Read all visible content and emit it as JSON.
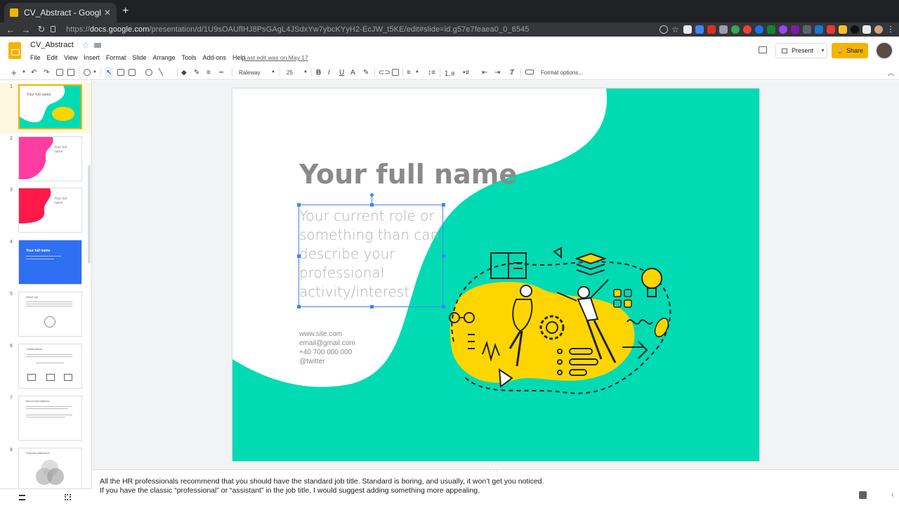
{
  "browser": {
    "tab_title": "CV_Abstract - Google Slides",
    "tab_close": "✕",
    "new_tab": "+",
    "url_prefix": "https://",
    "url_host": "docs.google.com",
    "url_path": "/presentation/d/1U9sOAUflHJ8PsGAgL4JSdxYw7ybcKYyH2-EcJW_t5KE/edit#slide=id.g57e7feaea0_0_6545"
  },
  "doc": {
    "title": "CV_Abstract",
    "menus": [
      "File",
      "Edit",
      "View",
      "Insert",
      "Format",
      "Slide",
      "Arrange",
      "Tools",
      "Add-ons",
      "Help"
    ],
    "last_edit": "Last edit was on May 17",
    "present_label": "Present",
    "share_label": "Share"
  },
  "toolbar": {
    "font": "Raleway",
    "font_size": "25",
    "format_options": "Format options..."
  },
  "filmstrip": {
    "slides": [
      {
        "num": "1",
        "title": "Your full name"
      },
      {
        "num": "2",
        "title": "Your full name"
      },
      {
        "num": "3",
        "title": "Your full name"
      },
      {
        "num": "4",
        "title": "Your full name"
      },
      {
        "num": "5",
        "title": "About me"
      },
      {
        "num": "6",
        "title": "Certifications"
      },
      {
        "num": "7",
        "title": "Recommendations"
      },
      {
        "num": "8",
        "title": "Purpose statement"
      }
    ]
  },
  "slide": {
    "title": "Your full name",
    "subtitle": "Your current role or something than can describe your professional activity/interest",
    "contacts": [
      "www.site.com",
      "email@gmail.com",
      "+40 700 000 000",
      "@twitter"
    ]
  },
  "notes": {
    "line1": "All the HR professionals recommend that you should have the standard job title. Standard is boring, and usually, it won’t get you noticed.",
    "line2": "If you have the classic “professional” or “assistant” in the job title, I would suggest adding something more appealing."
  },
  "colors": {
    "teal": "#00dbb4",
    "yellow": "#ffd500",
    "accent": "#f4b400",
    "selection": "#4285f4"
  }
}
